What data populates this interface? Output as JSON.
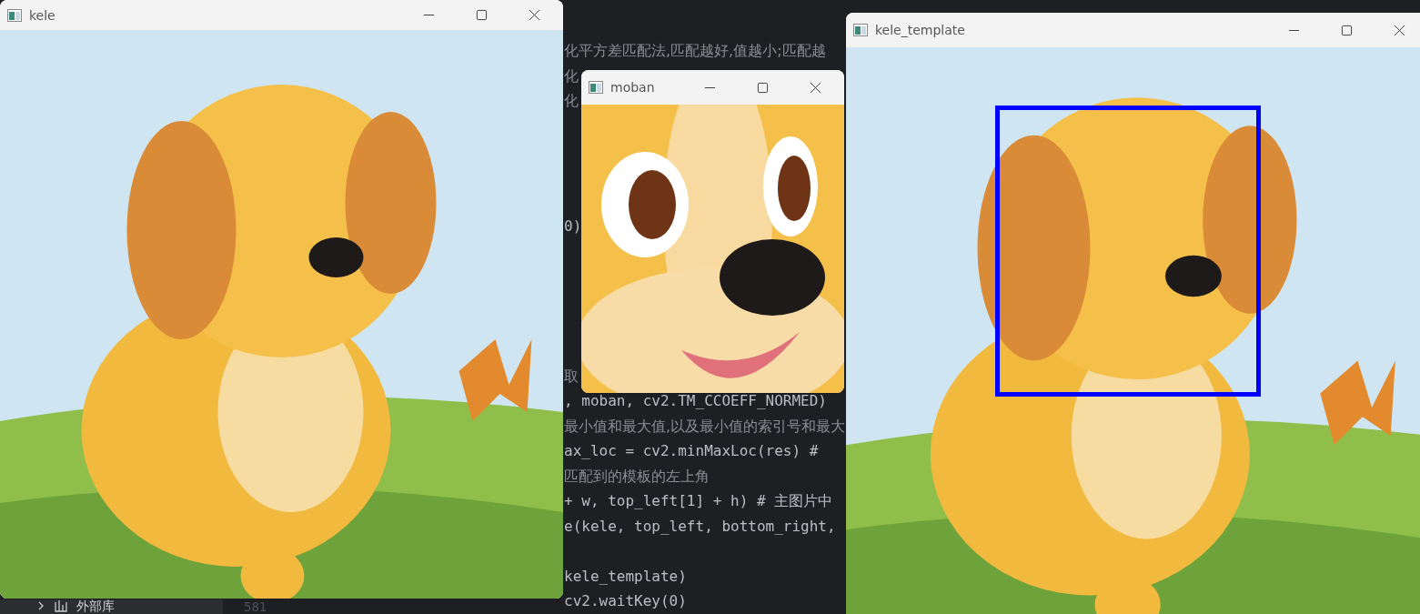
{
  "editor": {
    "code_lines": [
      {
        "text": "化平方差匹配法,匹配越好,值越小;匹配越",
        "kind": "comment"
      },
      {
        "text": "化",
        "kind": "comment"
      },
      {
        "text": "化",
        "kind": "comment"
      },
      {
        "text": "0)",
        "kind": "code"
      },
      {
        "text": "取",
        "kind": "comment"
      },
      {
        "text": ", moban, cv2.TM_CCOEFF_NORMED)",
        "kind": "code"
      },
      {
        "text": "最小值和最大值,以及最小值的索引号和最大",
        "kind": "comment"
      },
      {
        "text": "ax_loc = cv2.minMaxLoc(res)  #",
        "kind": "code"
      },
      {
        "text": "匹配到的模板的左上角",
        "kind": "comment"
      },
      {
        "text": "+ w, top_left[1] + h)  # 主图片中",
        "kind": "code"
      },
      {
        "text": "e(kele, top_left, bottom_right,",
        "kind": "code"
      },
      {
        "text": "kele_template)",
        "kind": "code"
      },
      {
        "text": "cv2.waitKey(0)",
        "kind": "code"
      }
    ],
    "line_number": "581",
    "sidebar_item": {
      "label": "外部库",
      "expanded": false
    }
  },
  "windows": [
    {
      "title": "kele",
      "kind": "picture"
    },
    {
      "title": "moban",
      "kind": "picture"
    },
    {
      "title": "kele_template",
      "kind": "picture"
    }
  ]
}
